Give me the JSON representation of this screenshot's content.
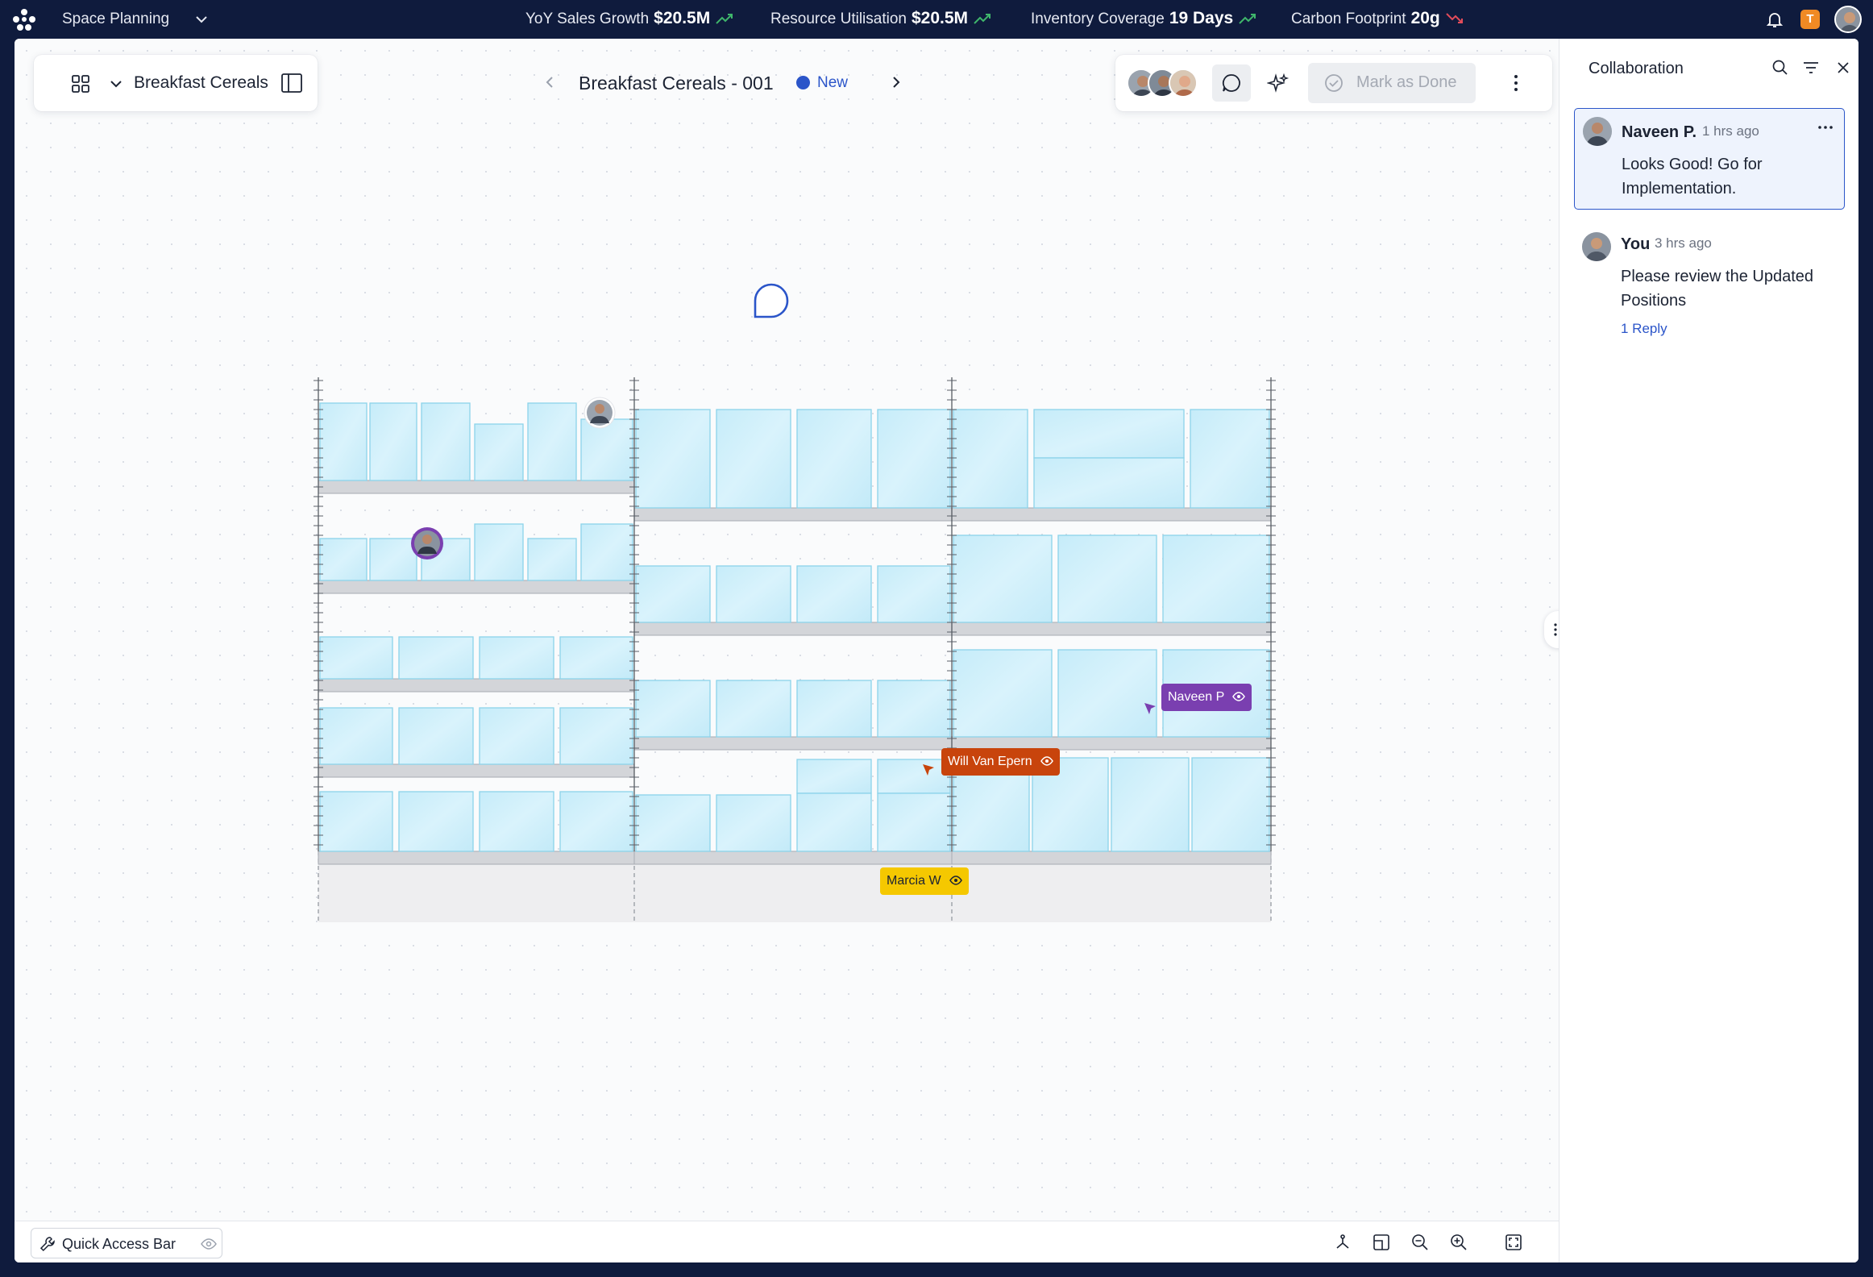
{
  "app": {
    "title": "Space Planning"
  },
  "kpis": [
    {
      "label": "YoY Sales Growth",
      "value": "$20.5M",
      "trend": "up"
    },
    {
      "label": "Resource Utilisation",
      "value": "$20.5M",
      "trend": "up"
    },
    {
      "label": "Inventory Coverage",
      "value": "19 Days",
      "trend": "up"
    },
    {
      "label": "Carbon Footprint",
      "value": "20g",
      "trend": "down"
    }
  ],
  "user_badge": "T",
  "toolbar": {
    "category": "Breakfast Cereals",
    "document_title": "Breakfast Cereals - 001",
    "status": "New",
    "mark_done": "Mark as Done"
  },
  "collaborators": [
    {
      "name": "Naveen P",
      "color": "#7a3fb0"
    },
    {
      "name": "Will Van Epern",
      "color": "#c8440c"
    },
    {
      "name": "Marcia W",
      "color": "#f5c800"
    }
  ],
  "panel": {
    "title": "Collaboration",
    "comments": [
      {
        "author": "Naveen P.",
        "time": "1 hrs ago",
        "text": "Looks Good! Go for Implementation."
      },
      {
        "author": "You",
        "time": "3 hrs ago",
        "text": "Please review the Updated Positions",
        "reply": "1 Reply"
      }
    ]
  },
  "bottom": {
    "quick_access": "Quick Access Bar"
  },
  "colors": {
    "accent": "#2b55c9",
    "navy": "#0f1b3d",
    "product": "#cdeef9",
    "shelf": "#d3d5d9"
  }
}
